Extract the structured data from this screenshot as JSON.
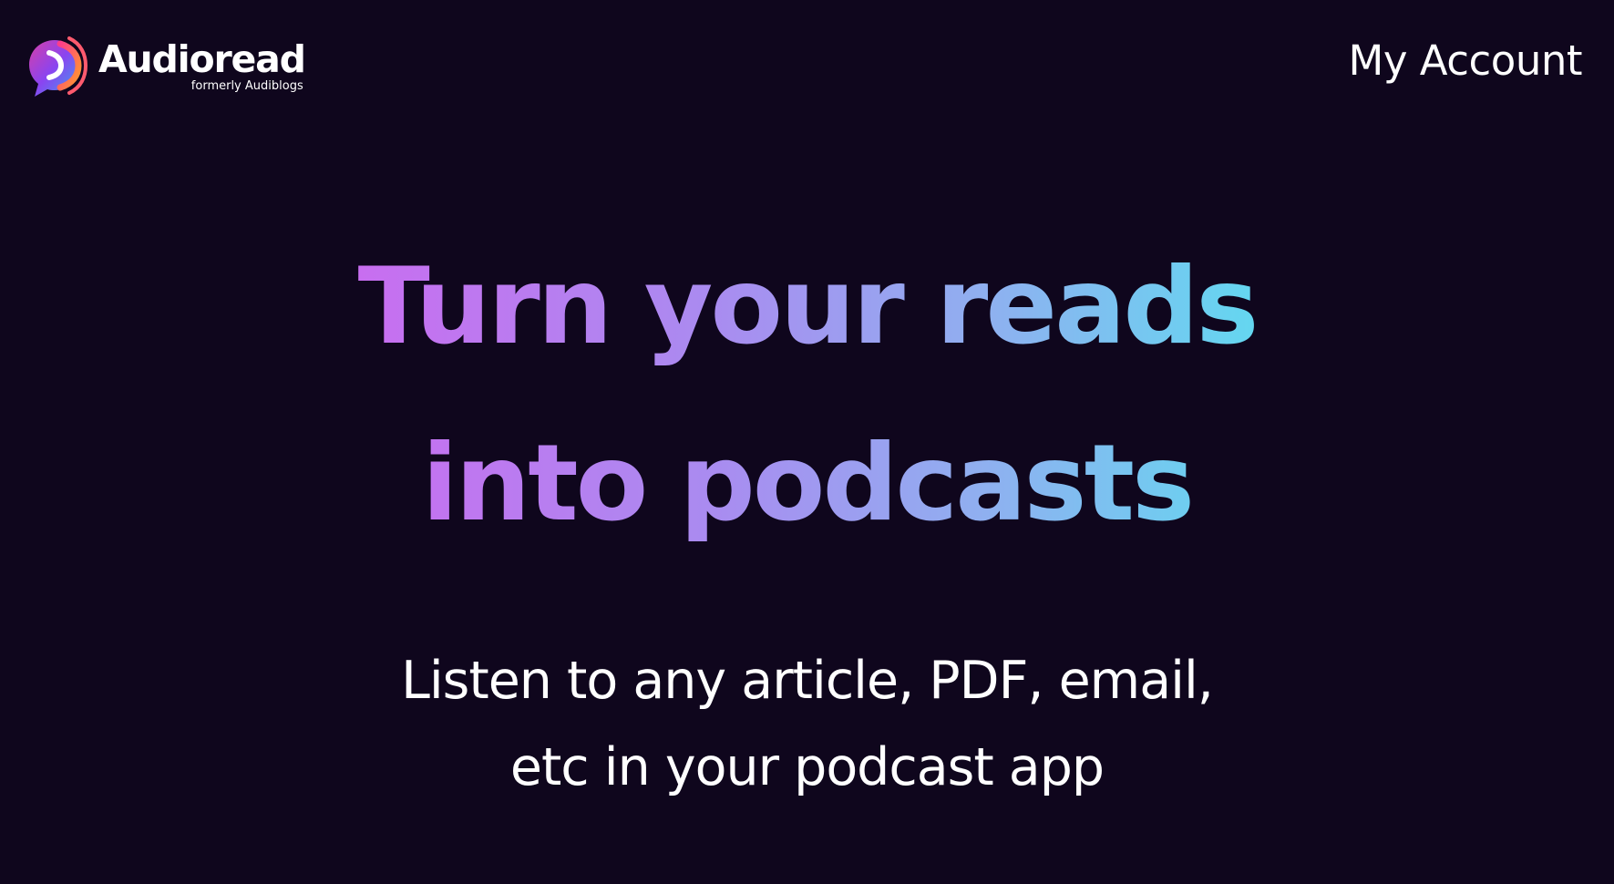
{
  "header": {
    "brand_name": "Audioread",
    "brand_subtitle": "formerly Audiblogs",
    "account_link": "My Account",
    "logo_icon": "speech-bubble-sound-icon"
  },
  "hero": {
    "headline_line1": "Turn your reads",
    "headline_line2": "into podcasts",
    "subhead_line1": "Listen to any article, PDF, email,",
    "subhead_line2": "etc in your podcast app"
  },
  "colors": {
    "background": "#0f061d",
    "text": "#ffffff",
    "gradient_start": "#c86ef0",
    "gradient_end": "#64d7f0",
    "logo_pink": "#e0338f",
    "logo_orange": "#ff8a2a",
    "logo_purple": "#8a44f0",
    "logo_blue": "#3aa3f0"
  }
}
